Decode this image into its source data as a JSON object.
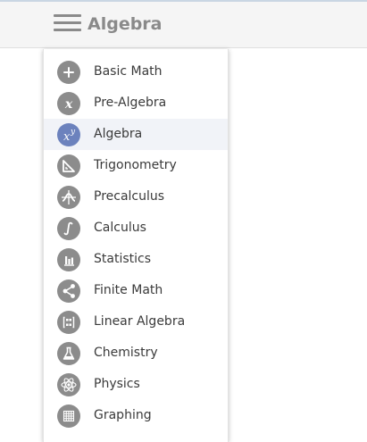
{
  "header": {
    "title": "Algebra",
    "menu_icon": "hamburger-menu-icon"
  },
  "colors": {
    "icon_gray": "#8c8c8c",
    "active_icon": "#6c82bd",
    "active_row": "#f1f3f8",
    "header_bg": "#f5f5f5"
  },
  "menu": {
    "selected": "Algebra",
    "items": [
      {
        "label": "Basic Math",
        "icon": "plus-icon"
      },
      {
        "label": "Pre-Algebra",
        "icon": "x-variable-icon"
      },
      {
        "label": "Algebra",
        "icon": "x-power-y-icon"
      },
      {
        "label": "Trigonometry",
        "icon": "triangle-ruler-icon"
      },
      {
        "label": "Precalculus",
        "icon": "function-graph-icon"
      },
      {
        "label": "Calculus",
        "icon": "integral-icon"
      },
      {
        "label": "Statistics",
        "icon": "bar-chart-icon"
      },
      {
        "label": "Finite Math",
        "icon": "network-nodes-icon"
      },
      {
        "label": "Linear Algebra",
        "icon": "matrix-icon"
      },
      {
        "label": "Chemistry",
        "icon": "flask-icon"
      },
      {
        "label": "Physics",
        "icon": "atom-icon"
      },
      {
        "label": "Graphing",
        "icon": "grid-icon"
      }
    ]
  }
}
